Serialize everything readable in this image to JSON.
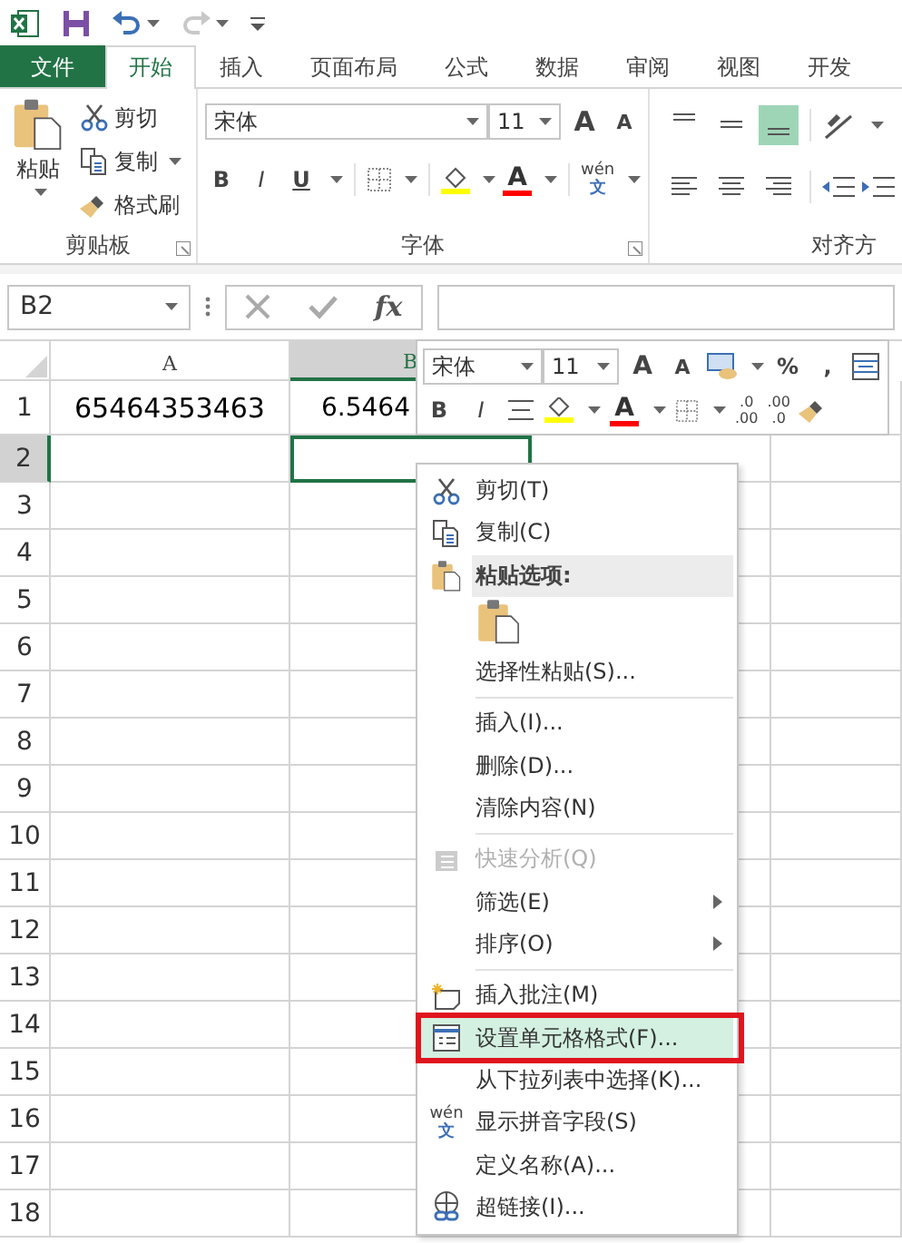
{
  "quick_access": {
    "redo_disabled": true
  },
  "tabs": [
    {
      "label": "文件",
      "kind": "file",
      "selected": false
    },
    {
      "label": "开始",
      "kind": "tab",
      "selected": true
    },
    {
      "label": "插入",
      "kind": "tab",
      "selected": false
    },
    {
      "label": "页面布局",
      "kind": "tab",
      "selected": false
    },
    {
      "label": "公式",
      "kind": "tab",
      "selected": false
    },
    {
      "label": "数据",
      "kind": "tab",
      "selected": false
    },
    {
      "label": "审阅",
      "kind": "tab",
      "selected": false
    },
    {
      "label": "视图",
      "kind": "tab",
      "selected": false
    },
    {
      "label": "开发",
      "kind": "tab",
      "selected": false
    }
  ],
  "ribbon": {
    "clipboard": {
      "paste": "粘贴",
      "cut": "剪切",
      "copy": "复制",
      "format_painter": "格式刷",
      "label": "剪贴板"
    },
    "font": {
      "font_name": "宋体",
      "font_size": "11",
      "grow": "A",
      "shrink": "A",
      "bold": "B",
      "italic": "I",
      "underline": "U",
      "font_color": "A",
      "phonetic": [
        "wén",
        "文"
      ],
      "label": "字体"
    },
    "alignment": {
      "vertical": [
        {
          "selected": false
        },
        {
          "selected": false
        },
        {
          "selected": true
        }
      ],
      "horizontal": [
        {
          "selected": false
        },
        {
          "selected": false
        },
        {
          "selected": false
        }
      ],
      "label": "对齐方"
    }
  },
  "formula_bar": {
    "name_box": "B2",
    "fx": "fx"
  },
  "sheet": {
    "columns": [
      {
        "label": "A",
        "selected": false
      },
      {
        "label": "B",
        "selected": true
      }
    ],
    "rows": [
      {
        "label": "1",
        "selected": false,
        "cells": [
          "65464353463",
          "6.5464"
        ]
      },
      {
        "label": "2",
        "selected": true
      },
      {
        "label": "3",
        "selected": false
      },
      {
        "label": "4",
        "selected": false
      },
      {
        "label": "5",
        "selected": false
      },
      {
        "label": "6",
        "selected": false
      },
      {
        "label": "7",
        "selected": false
      },
      {
        "label": "8",
        "selected": false
      },
      {
        "label": "9",
        "selected": false
      },
      {
        "label": "10",
        "selected": false
      },
      {
        "label": "11",
        "selected": false
      },
      {
        "label": "12",
        "selected": false
      },
      {
        "label": "13",
        "selected": false
      },
      {
        "label": "14",
        "selected": false
      },
      {
        "label": "15",
        "selected": false
      },
      {
        "label": "16",
        "selected": false
      },
      {
        "label": "17",
        "selected": false
      },
      {
        "label": "18",
        "selected": false
      }
    ]
  },
  "mini_toolbar": {
    "font_name": "宋体",
    "font_size": "11",
    "grow": "A",
    "shrink": "A",
    "percent": "%",
    "comma": ",",
    "bold": "B",
    "italic": "I",
    "font_color": "A",
    "inc_decimal": [
      ".0",
      ".00"
    ],
    "dec_decimal": [
      ".00",
      ".0"
    ]
  },
  "context_menu": {
    "items": [
      {
        "kind": "item",
        "label": "剪切(T)",
        "disabled": false,
        "selected": false,
        "submenu": false,
        "annotated": false
      },
      {
        "kind": "item",
        "label": "复制(C)",
        "disabled": false,
        "selected": false,
        "submenu": false,
        "annotated": false
      },
      {
        "kind": "header",
        "label": "粘贴选项:"
      },
      {
        "kind": "paste-options"
      },
      {
        "kind": "item",
        "label": "选择性粘贴(S)...",
        "disabled": false,
        "selected": false,
        "submenu": false,
        "annotated": false
      },
      {
        "kind": "separator"
      },
      {
        "kind": "item",
        "label": "插入(I)...",
        "disabled": false,
        "selected": false,
        "submenu": false,
        "annotated": false
      },
      {
        "kind": "item",
        "label": "删除(D)...",
        "disabled": false,
        "selected": false,
        "submenu": false,
        "annotated": false
      },
      {
        "kind": "item",
        "label": "清除内容(N)",
        "disabled": false,
        "selected": false,
        "submenu": false,
        "annotated": false
      },
      {
        "kind": "separator"
      },
      {
        "kind": "item",
        "label": "快速分析(Q)",
        "disabled": true,
        "selected": false,
        "submenu": false,
        "annotated": false
      },
      {
        "kind": "item",
        "label": "筛选(E)",
        "disabled": false,
        "selected": false,
        "submenu": true,
        "annotated": false
      },
      {
        "kind": "item",
        "label": "排序(O)",
        "disabled": false,
        "selected": false,
        "submenu": true,
        "annotated": false
      },
      {
        "kind": "separator"
      },
      {
        "kind": "item",
        "label": "插入批注(M)",
        "disabled": false,
        "selected": false,
        "submenu": false,
        "annotated": false
      },
      {
        "kind": "item",
        "label": "设置单元格格式(F)...",
        "disabled": false,
        "selected": true,
        "submenu": false,
        "annotated": true
      },
      {
        "kind": "item",
        "label": "从下拉列表中选择(K)...",
        "disabled": false,
        "selected": false,
        "submenu": false,
        "annotated": false
      },
      {
        "kind": "item",
        "label": "显示拼音字段(S)",
        "disabled": false,
        "selected": false,
        "submenu": false,
        "annotated": false,
        "icon_text": [
          "wén",
          "文"
        ]
      },
      {
        "kind": "item",
        "label": "定义名称(A)...",
        "disabled": false,
        "selected": false,
        "submenu": false,
        "annotated": false
      },
      {
        "kind": "item",
        "label": "超链接(I)...",
        "disabled": false,
        "selected": false,
        "submenu": false,
        "annotated": false
      }
    ]
  }
}
